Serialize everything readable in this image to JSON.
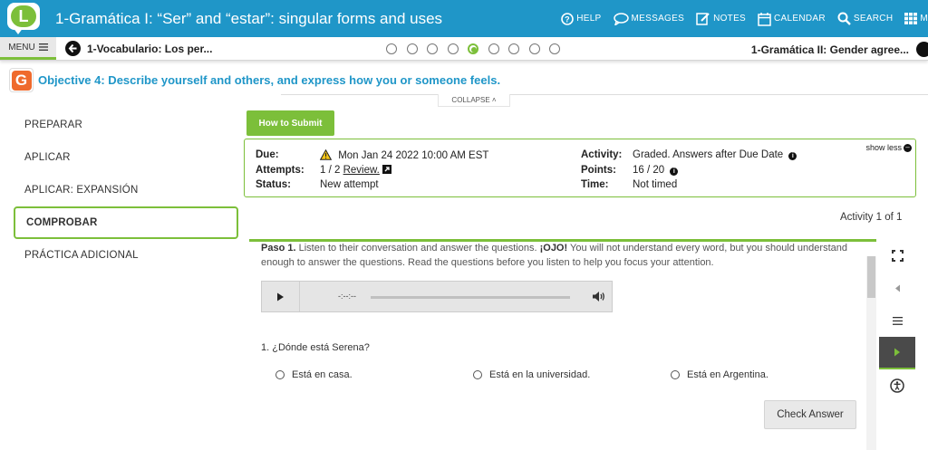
{
  "header": {
    "logo_letter": "L",
    "title": "1-Gramática I: “Ser” and “estar”: singular forms and uses",
    "nav": [
      {
        "label": "HELP",
        "icon": "help-icon"
      },
      {
        "label": "MESSAGES",
        "icon": "messages-icon"
      },
      {
        "label": "NOTES",
        "icon": "notes-icon"
      },
      {
        "label": "CALENDAR",
        "icon": "calendar-icon"
      },
      {
        "label": "SEARCH",
        "icon": "search-icon"
      },
      {
        "label": "M",
        "icon": "more-grid-icon"
      }
    ]
  },
  "subbar": {
    "menu_label": "MENU",
    "prev_label": "1-Vocabulario: Los per...",
    "next_label": "1-Gramática II: Gender agree...",
    "progress": {
      "total": 9,
      "current": 5
    }
  },
  "objective": {
    "badge": "G",
    "text": "Objective 4: Describe yourself and others, and express how you or someone feels.",
    "collapse_label": "COLLAPSE"
  },
  "leftnav": {
    "items": [
      {
        "label": "PREPARAR",
        "active": false
      },
      {
        "label": "APLICAR",
        "active": false
      },
      {
        "label": "APLICAR: EXPANSIÓN",
        "active": false
      },
      {
        "label": "COMPROBAR",
        "active": true
      },
      {
        "label": "PRÁCTICA ADICIONAL",
        "active": false
      }
    ]
  },
  "submit_button": "How to Submit",
  "info": {
    "due_label": "Due:",
    "due_value": "Mon Jan 24 2022 10:00 AM EST",
    "attempts_label": "Attempts:",
    "attempts_value": "1 / 2",
    "review_label": "Review.",
    "status_label": "Status:",
    "status_value": "New attempt",
    "activity_label": "Activity:",
    "activity_value": "Graded. Answers after Due Date",
    "points_label": "Points:",
    "points_value": "16 / 20",
    "time_label": "Time:",
    "time_value": "Not timed",
    "show_less": "show less"
  },
  "activity_counter": "Activity 1 of 1",
  "activity": {
    "step_label": "Paso 1.",
    "instruction_1": " Listen to their conversation and answer the questions. ",
    "ojo": "¡OJO!",
    "instruction_2": " You will not understand every word, but you should understand enough to answer the questions. Read the questions before you listen to help you focus your attention.",
    "audio_time": "-:--:--",
    "question": "1. ¿Dónde está Serena?",
    "options": [
      "Está en casa.",
      "Está en la universidad.",
      "Está en Argentina."
    ],
    "check_answer": "Check Answer"
  },
  "colors": {
    "header_blue": "#1f96c8",
    "accent_green": "#7cbf3a",
    "objective_orange": "#ef6a2d"
  }
}
